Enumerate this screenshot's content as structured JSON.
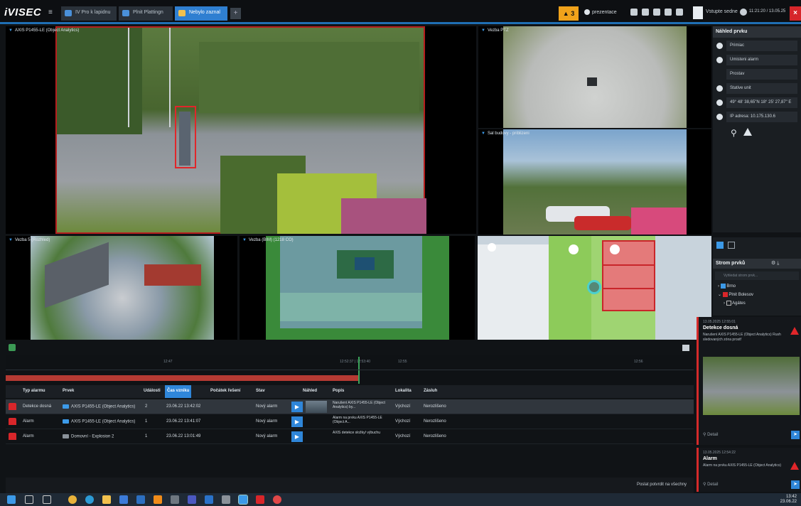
{
  "app": {
    "logo": "iVISEC",
    "menu_icon": "hamburger-icon",
    "tabs": [
      {
        "label": "IV Pro k lapidnu",
        "icon": "monitor-icon",
        "color": "#4a90d9"
      },
      {
        "label": "Plnit Plattingn",
        "icon": "camera-icon",
        "color": "#4a90d9"
      },
      {
        "label": "Nebylo zaznal",
        "icon": "folder-icon",
        "color": "#f2c14e",
        "active": true
      }
    ],
    "add_tab_label": "+",
    "alarm_count": "▲ 3",
    "user_label": "prezentace",
    "entry_label": "Vstupte sedne",
    "time_label": "11:21:20 / 13.05.25",
    "close_label": "×"
  },
  "tiles": [
    {
      "label": "AXIS P1455-LE (Object Analytics)"
    },
    {
      "label": "Vezba PTZ"
    },
    {
      "label": "Sal budovy - priblizeni"
    },
    {
      "label": "Vezba 5 (Rozhled)"
    },
    {
      "label": "Vezba (BIM) (1218 CO)"
    },
    {
      "label": ""
    }
  ],
  "right_panel": {
    "title": "Náhled prvku",
    "properties": [
      {
        "icon": "tag-icon",
        "value": "Primiac"
      },
      {
        "icon": "info-icon",
        "value": "Umisteni alarm"
      },
      {
        "icon": "",
        "value": "Prostav"
      },
      {
        "icon": "status-icon",
        "value": "Stative unit"
      },
      {
        "icon": "location-icon",
        "value": "49° 48' 38,65\"N 18° 25' 27,87\" E"
      },
      {
        "icon": "network-icon",
        "value": "IP adresa: 10.175.130.6"
      }
    ],
    "tree_title": "Strom prvků",
    "tree_search_placeholder": "Vyhledat strom prvk...",
    "tree_items": [
      "Brno",
      "Plnit Bolesov",
      "Agátes"
    ]
  },
  "alarm_cards": [
    {
      "time": "13.05.2025 12:55:01",
      "title": "Detekce dosná",
      "desc": "Narušení AXIS P1455-LE (Object Analytics) Rush sledovaných zóna prostř",
      "search_placeholder": "Detail"
    },
    {
      "time": "13.05.2025 12:54:22",
      "title": "Alarm",
      "desc": "Alarm na prvku AXIS P1455-LE (Object Analytics)",
      "search_placeholder": "Detail"
    }
  ],
  "timeline": {
    "ticks": [
      "12:47",
      "12:52:37 | 12:53:40",
      "12:55",
      "12:56"
    ]
  },
  "table": {
    "headers": [
      "Typ alarmu",
      "Prvek",
      "Události",
      "Čas vzniku",
      "Počátek řešení",
      "Stav",
      "Náhled",
      "Popis",
      "Lokalita",
      "Zásluh"
    ],
    "sorted_header": "Čas vzniku",
    "rows": [
      {
        "type": "Detekce dosná",
        "element": "AXIS P1455-LE (Object Analytics)",
        "element_icon": "camera-icon",
        "events": "2",
        "time": "23.06.22 13:42:02",
        "start": "",
        "state": "Nový alarm",
        "desc": "Narušení AXIS P1455-LE (Object Analytics) by...",
        "location": "Výchozí",
        "assignee": "Nerozlišeno",
        "selected": true,
        "thumb": true
      },
      {
        "type": "Alarm",
        "element": "AXIS P1455-LE (Object Analytics)",
        "element_icon": "camera-icon",
        "events": "1",
        "time": "23.06.22 13:41:07",
        "start": "",
        "state": "Nový alarm",
        "desc": "Alarm na prvku AXIS P1455-LE (Object A...",
        "location": "Výchozí",
        "assignee": "Nerozlišeno",
        "selected": false,
        "thumb": false
      },
      {
        "type": "Alarm",
        "element": "Domovní - Explosion 2",
        "element_icon": "sensor-icon",
        "events": "1",
        "time": "23.06.22 13:01:49",
        "start": "",
        "state": "Nový alarm",
        "desc": "AXIS detekce složky/ výbuchu",
        "location": "Výchozí",
        "assignee": "Nerozlišeno",
        "selected": false,
        "thumb": false
      }
    ],
    "close_all_label": "Poslat potvrdit na všechny"
  },
  "taskbar": {
    "clock_time": "13:42",
    "clock_date": "23.06.22",
    "icons": [
      "windows-icon",
      "search-icon",
      "taskview-icon",
      "chrome-icon",
      "edge-icon",
      "explorer-icon",
      "store-icon",
      "mail-icon",
      "vlc-icon",
      "app-icon",
      "teams-icon",
      "outlook-icon",
      "calculator-icon",
      "ivisec-icon",
      "pdf-icon",
      "chrome-alt-icon"
    ]
  },
  "colors": {
    "accent": "#2f86d9",
    "alarm_red": "#d8262a",
    "warning": "#f0a21b"
  }
}
